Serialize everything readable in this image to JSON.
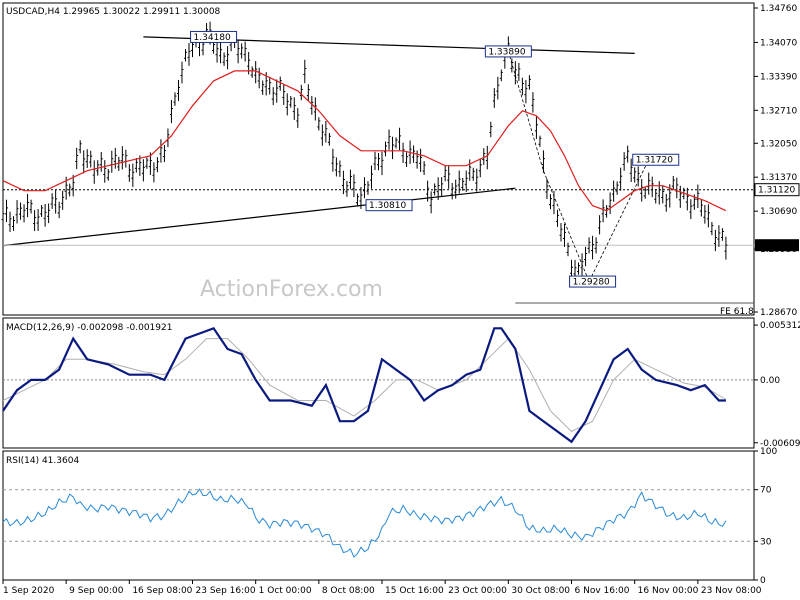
{
  "watermark": "ActionForex.com",
  "chart_data": {
    "type": "line",
    "price_panel": {
      "title": "USDCAD,H4  1.29965 1.30022 1.29911 1.30008",
      "yticks": [
        "1.34760",
        "1.34070",
        "1.33390",
        "1.32710",
        "1.32050",
        "1.31370",
        "1.30690",
        "1.29930",
        "1.28670"
      ],
      "ytick_values": [
        1.3476,
        1.3407,
        1.3339,
        1.3271,
        1.3205,
        1.3137,
        1.3069,
        1.2993,
        1.2867
      ],
      "ylim": [
        1.2861,
        1.3486
      ],
      "current_price": "1.30008",
      "current_value": 1.30008,
      "level_line": "1.31120",
      "level_value": 1.3112,
      "fe_label": "FE 61.8",
      "fe_value": 1.2885,
      "labels": [
        {
          "text": "1.34180",
          "x": 30,
          "value": 1.3418
        },
        {
          "text": "1.33890",
          "x": 72,
          "value": 1.3389
        },
        {
          "text": "1.30810",
          "x": 55,
          "value": 1.3081
        },
        {
          "text": "1.31720",
          "x": 93,
          "value": 1.3172
        },
        {
          "text": "1.29280",
          "x": 84,
          "value": 1.2928
        }
      ],
      "close_points": [
        [
          0,
          1.305
        ],
        [
          3,
          1.307
        ],
        [
          6,
          1.306
        ],
        [
          8,
          1.309
        ],
        [
          10,
          1.312
        ],
        [
          11,
          1.32
        ],
        [
          13,
          1.315
        ],
        [
          15,
          1.316
        ],
        [
          17,
          1.317
        ],
        [
          19,
          1.315
        ],
        [
          21,
          1.316
        ],
        [
          23,
          1.318
        ],
        [
          24,
          1.326
        ],
        [
          25,
          1.333
        ],
        [
          27,
          1.34
        ],
        [
          29,
          1.342
        ],
        [
          31,
          1.338
        ],
        [
          33,
          1.34
        ],
        [
          35,
          1.338
        ],
        [
          36,
          1.333
        ],
        [
          38,
          1.332
        ],
        [
          40,
          1.33
        ],
        [
          42,
          1.327
        ],
        [
          43,
          1.333
        ],
        [
          45,
          1.325
        ],
        [
          47,
          1.318
        ],
        [
          49,
          1.312
        ],
        [
          51,
          1.31
        ],
        [
          53,
          1.315
        ],
        [
          55,
          1.321
        ],
        [
          57,
          1.319
        ],
        [
          59,
          1.318
        ],
        [
          61,
          1.31
        ],
        [
          63,
          1.313
        ],
        [
          65,
          1.312
        ],
        [
          67,
          1.314
        ],
        [
          69,
          1.318
        ],
        [
          70,
          1.328
        ],
        [
          71,
          1.336
        ],
        [
          72,
          1.339
        ],
        [
          73,
          1.334
        ],
        [
          75,
          1.332
        ],
        [
          76,
          1.324
        ],
        [
          77,
          1.316
        ],
        [
          78,
          1.31
        ],
        [
          79,
          1.305
        ],
        [
          80,
          1.301
        ],
        [
          81,
          1.297
        ],
        [
          82,
          1.294
        ],
        [
          83,
          1.298
        ],
        [
          84,
          1.3
        ],
        [
          85,
          1.304
        ],
        [
          87,
          1.31
        ],
        [
          88,
          1.315
        ],
        [
          89,
          1.317
        ],
        [
          90,
          1.314
        ],
        [
          92,
          1.311
        ],
        [
          94,
          1.31
        ],
        [
          96,
          1.311
        ],
        [
          98,
          1.309
        ],
        [
          100,
          1.307
        ],
        [
          101,
          1.304
        ],
        [
          102,
          1.301
        ],
        [
          103,
          1.3
        ]
      ],
      "ma_points": [
        [
          0,
          1.313
        ],
        [
          3,
          1.311
        ],
        [
          6,
          1.311
        ],
        [
          9,
          1.313
        ],
        [
          12,
          1.315
        ],
        [
          15,
          1.316
        ],
        [
          18,
          1.317
        ],
        [
          21,
          1.318
        ],
        [
          24,
          1.322
        ],
        [
          27,
          1.328
        ],
        [
          30,
          1.333
        ],
        [
          33,
          1.335
        ],
        [
          36,
          1.335
        ],
        [
          39,
          1.333
        ],
        [
          42,
          1.331
        ],
        [
          45,
          1.327
        ],
        [
          48,
          1.322
        ],
        [
          51,
          1.319
        ],
        [
          54,
          1.319
        ],
        [
          57,
          1.319
        ],
        [
          60,
          1.318
        ],
        [
          63,
          1.316
        ],
        [
          66,
          1.316
        ],
        [
          69,
          1.318
        ],
        [
          72,
          1.324
        ],
        [
          74,
          1.327
        ],
        [
          76,
          1.326
        ],
        [
          78,
          1.323
        ],
        [
          80,
          1.318
        ],
        [
          82,
          1.312
        ],
        [
          84,
          1.308
        ],
        [
          86,
          1.307
        ],
        [
          88,
          1.309
        ],
        [
          90,
          1.311
        ],
        [
          92,
          1.312
        ],
        [
          94,
          1.312
        ],
        [
          96,
          1.311
        ],
        [
          98,
          1.31
        ],
        [
          100,
          1.309
        ],
        [
          103,
          1.307
        ]
      ]
    },
    "macd_panel": {
      "title": "MACD(12,26,9) -0.002098 -0.001921",
      "yticks": [
        "0.005312",
        "0.00",
        "-0.006092"
      ],
      "ytick_values": [
        0.005312,
        0,
        -0.006092
      ],
      "ylim": [
        -0.0066,
        0.006
      ],
      "macd_points": [
        [
          0,
          -0.003
        ],
        [
          2,
          -0.001
        ],
        [
          4,
          0.0
        ],
        [
          6,
          0.0
        ],
        [
          8,
          0.001
        ],
        [
          10,
          0.004
        ],
        [
          12,
          0.002
        ],
        [
          15,
          0.0015
        ],
        [
          18,
          0.0005
        ],
        [
          21,
          0.0005
        ],
        [
          23,
          0.0
        ],
        [
          26,
          0.004
        ],
        [
          28,
          0.0045
        ],
        [
          30,
          0.005
        ],
        [
          32,
          0.003
        ],
        [
          34,
          0.0025
        ],
        [
          36,
          0.0
        ],
        [
          38,
          -0.002
        ],
        [
          41,
          -0.002
        ],
        [
          44,
          -0.0025
        ],
        [
          46,
          -0.0005
        ],
        [
          48,
          -0.004
        ],
        [
          50,
          -0.004
        ],
        [
          52,
          -0.003
        ],
        [
          54,
          0.002
        ],
        [
          56,
          0.001
        ],
        [
          58,
          0.0
        ],
        [
          60,
          -0.002
        ],
        [
          62,
          -0.001
        ],
        [
          64,
          -0.0005
        ],
        [
          66,
          0.0005
        ],
        [
          68,
          0.001
        ],
        [
          70,
          0.005
        ],
        [
          71,
          0.005
        ],
        [
          73,
          0.003
        ],
        [
          75,
          -0.003
        ],
        [
          77,
          -0.004
        ],
        [
          79,
          -0.005
        ],
        [
          81,
          -0.006
        ],
        [
          83,
          -0.004
        ],
        [
          85,
          -0.001
        ],
        [
          87,
          0.002
        ],
        [
          89,
          0.003
        ],
        [
          91,
          0.001
        ],
        [
          93,
          0.0
        ],
        [
          96,
          -0.0005
        ],
        [
          98,
          -0.001
        ],
        [
          100,
          -0.0005
        ],
        [
          102,
          -0.002
        ],
        [
          103,
          -0.002
        ]
      ],
      "signal_points": [
        [
          0,
          -0.002
        ],
        [
          3,
          -0.001
        ],
        [
          6,
          0.0
        ],
        [
          9,
          0.002
        ],
        [
          12,
          0.002
        ],
        [
          16,
          0.0015
        ],
        [
          20,
          0.0008
        ],
        [
          23,
          0.0005
        ],
        [
          26,
          0.002
        ],
        [
          29,
          0.004
        ],
        [
          32,
          0.004
        ],
        [
          35,
          0.002
        ],
        [
          38,
          -0.0005
        ],
        [
          42,
          -0.002
        ],
        [
          46,
          -0.002
        ],
        [
          50,
          -0.0035
        ],
        [
          53,
          -0.002
        ],
        [
          56,
          0.0
        ],
        [
          59,
          0.0
        ],
        [
          62,
          -0.001
        ],
        [
          66,
          0.0
        ],
        [
          69,
          0.002
        ],
        [
          72,
          0.004
        ],
        [
          75,
          0.001
        ],
        [
          78,
          -0.003
        ],
        [
          81,
          -0.005
        ],
        [
          84,
          -0.004
        ],
        [
          87,
          0.0
        ],
        [
          90,
          0.002
        ],
        [
          93,
          0.001
        ],
        [
          97,
          -0.0003
        ],
        [
          100,
          -0.0007
        ],
        [
          103,
          -0.0019
        ]
      ]
    },
    "rsi_panel": {
      "title": "RSI(14) 41.3604",
      "yticks": [
        "100",
        "70",
        "30",
        "0"
      ],
      "ytick_values": [
        100,
        70,
        30,
        0
      ],
      "ylim": [
        0,
        100
      ],
      "rsi_points": [
        [
          0,
          45
        ],
        [
          2,
          44
        ],
        [
          4,
          47
        ],
        [
          6,
          52
        ],
        [
          8,
          60
        ],
        [
          10,
          65
        ],
        [
          11,
          58
        ],
        [
          13,
          55
        ],
        [
          15,
          57
        ],
        [
          17,
          54
        ],
        [
          19,
          52
        ],
        [
          21,
          48
        ],
        [
          23,
          50
        ],
        [
          25,
          60
        ],
        [
          27,
          68
        ],
        [
          29,
          67
        ],
        [
          31,
          62
        ],
        [
          33,
          63
        ],
        [
          35,
          58
        ],
        [
          36,
          48
        ],
        [
          38,
          43
        ],
        [
          40,
          45
        ],
        [
          42,
          44
        ],
        [
          44,
          40
        ],
        [
          46,
          35
        ],
        [
          48,
          25
        ],
        [
          50,
          20
        ],
        [
          52,
          25
        ],
        [
          54,
          38
        ],
        [
          55,
          52
        ],
        [
          57,
          55
        ],
        [
          59,
          50
        ],
        [
          61,
          48
        ],
        [
          63,
          46
        ],
        [
          65,
          48
        ],
        [
          67,
          52
        ],
        [
          69,
          58
        ],
        [
          71,
          62
        ],
        [
          73,
          55
        ],
        [
          75,
          40
        ],
        [
          77,
          38
        ],
        [
          79,
          40
        ],
        [
          81,
          35
        ],
        [
          83,
          33
        ],
        [
          85,
          40
        ],
        [
          87,
          47
        ],
        [
          89,
          52
        ],
        [
          91,
          66
        ],
        [
          93,
          58
        ],
        [
          95,
          50
        ],
        [
          97,
          48
        ],
        [
          99,
          52
        ],
        [
          101,
          45
        ],
        [
          103,
          43
        ]
      ]
    },
    "x_axis": {
      "range": [
        0,
        107
      ],
      "labels": [
        {
          "text": "1 Sep 2020",
          "x": 0
        },
        {
          "text": "9 Sep 00:00",
          "x": 9
        },
        {
          "text": "16 Sep 08:00",
          "x": 18
        },
        {
          "text": "23 Sep 16:00",
          "x": 27
        },
        {
          "text": "1 Oct 00:00",
          "x": 36
        },
        {
          "text": "8 Oct 08:00",
          "x": 45
        },
        {
          "text": "15 Oct 16:00",
          "x": 54
        },
        {
          "text": "23 Oct 00:00",
          "x": 63
        },
        {
          "text": "30 Oct 08:00",
          "x": 72
        },
        {
          "text": "6 Nov 16:00",
          "x": 81
        },
        {
          "text": "16 Nov 00:00",
          "x": 90
        },
        {
          "text": "23 Nov 08:00",
          "x": 99
        }
      ]
    },
    "grid": false
  }
}
